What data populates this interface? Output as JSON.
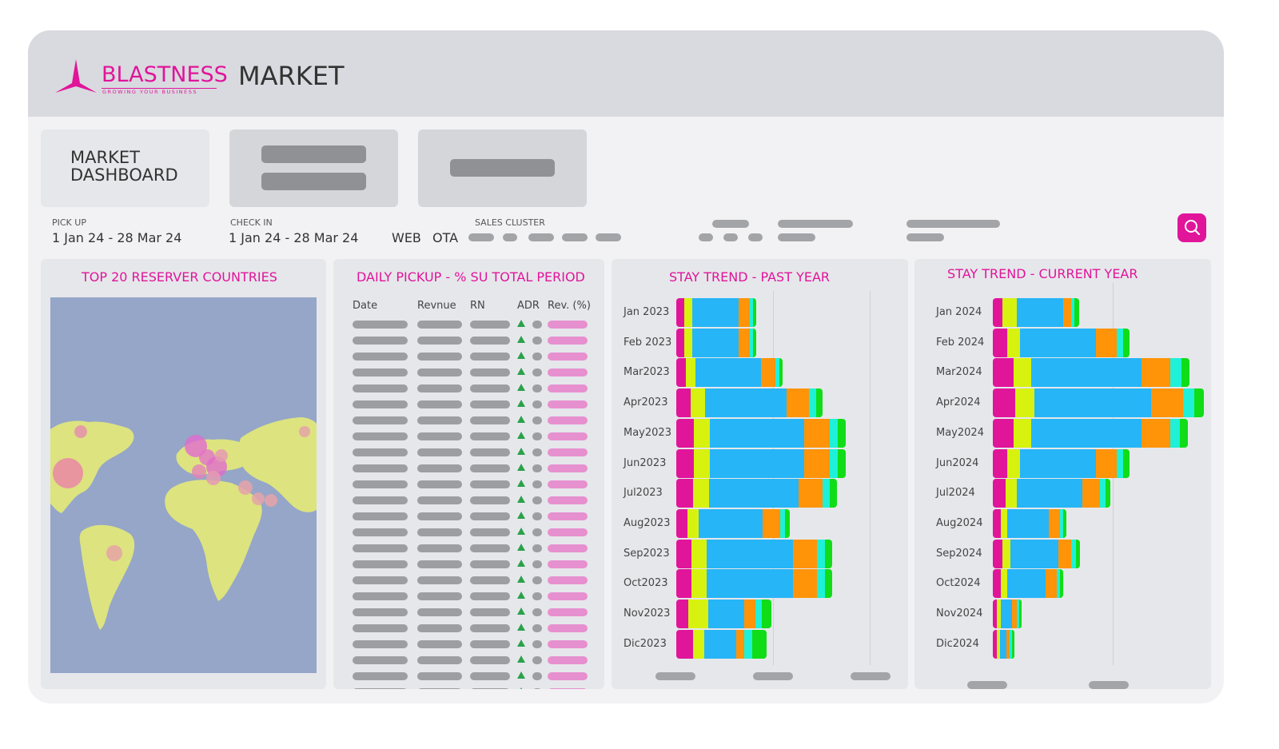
{
  "app": {
    "brand": "BLASTNESS",
    "tagline": "GROWING YOUR BUSINESS",
    "title": "MARKET"
  },
  "cards": {
    "dashboard_title_line1": "MARKET",
    "dashboard_title_line2": "DASHBOARD"
  },
  "filters": {
    "pickup": {
      "label": "PICK UP",
      "value": "1 Jan 24 - 28 Mar 24"
    },
    "checkin": {
      "label": "CHECK IN",
      "value": "1 Jan 24 - 28 Mar 24"
    },
    "channels": [
      "WEB",
      "OTA"
    ],
    "sales_cluster": {
      "label": "SALES CLUSTER"
    }
  },
  "colors": {
    "accent": "#e0159a",
    "segments": [
      "#e0159a",
      "#d7f20f",
      "#26b5f7",
      "#ff9408",
      "#1ff0d8",
      "#10dd18"
    ]
  },
  "icons": {
    "search": "search-icon",
    "logo": "triangle-logo-icon"
  },
  "panels": {
    "map": {
      "title": "TOP 20 RESERVER COUNTRIES"
    },
    "pickup": {
      "title": "DAILY PICKUP - % SU TOTAL PERIOD",
      "columns": [
        "Date",
        "Revnue",
        "RN",
        "ADR",
        "Rev. (%)"
      ],
      "row_count": 24
    },
    "past": {
      "title": "STAY TREND - PAST YEAR"
    },
    "current": {
      "title": "STAY TREND - CURRENT YEAR"
    }
  },
  "chart_data": [
    {
      "type": "bar",
      "title": "STAY TREND - PAST YEAR",
      "orientation": "horizontal-stacked",
      "categories": [
        "Jan 2023",
        "Feb 2023",
        "Mar2023",
        "Apr2023",
        "May2023",
        "Jun2023",
        "Jul2023",
        "Aug2023",
        "Sep2023",
        "Oct2023",
        "Nov2023",
        "Dic2023"
      ],
      "series": [
        {
          "values": [
            10,
            10,
            12,
            18,
            22,
            22,
            21,
            14,
            19,
            19,
            15,
            21
          ]
        },
        {
          "values": [
            10,
            10,
            12,
            18,
            20,
            20,
            20,
            14,
            19,
            19,
            25,
            14
          ]
        },
        {
          "values": [
            58,
            58,
            82,
            102,
            118,
            118,
            112,
            80,
            108,
            108,
            45,
            40
          ]
        },
        {
          "values": [
            14,
            14,
            18,
            28,
            32,
            32,
            30,
            22,
            30,
            30,
            14,
            10
          ]
        },
        {
          "values": [
            4,
            4,
            5,
            9,
            10,
            10,
            9,
            6,
            10,
            10,
            8,
            10
          ]
        },
        {
          "values": [
            4,
            4,
            4,
            8,
            10,
            10,
            9,
            6,
            9,
            9,
            12,
            18
          ]
        }
      ]
    },
    {
      "type": "bar",
      "title": "STAY TREND - CURRENT YEAR",
      "orientation": "horizontal-stacked",
      "categories": [
        "Jan 2024",
        "Feb 2024",
        "Mar2024",
        "Apr2024",
        "May2024",
        "Jun2024",
        "Jul2024",
        "Aug2024",
        "Sep2024",
        "Oct2024",
        "Nov2024",
        "Dic2024"
      ],
      "series": [
        {
          "values": [
            12,
            18,
            26,
            28,
            26,
            18,
            16,
            10,
            12,
            10,
            5,
            5
          ]
        },
        {
          "values": [
            18,
            16,
            22,
            24,
            22,
            16,
            14,
            8,
            10,
            8,
            5,
            4
          ]
        },
        {
          "values": [
            58,
            95,
            138,
            146,
            138,
            95,
            82,
            52,
            60,
            48,
            14,
            8
          ]
        },
        {
          "values": [
            10,
            26,
            36,
            40,
            36,
            26,
            22,
            14,
            16,
            14,
            6,
            4
          ]
        },
        {
          "values": [
            4,
            8,
            14,
            14,
            12,
            8,
            7,
            4,
            6,
            4,
            3,
            3
          ]
        },
        {
          "values": [
            6,
            8,
            10,
            12,
            10,
            8,
            6,
            4,
            5,
            4,
            3,
            3
          ]
        }
      ]
    }
  ]
}
